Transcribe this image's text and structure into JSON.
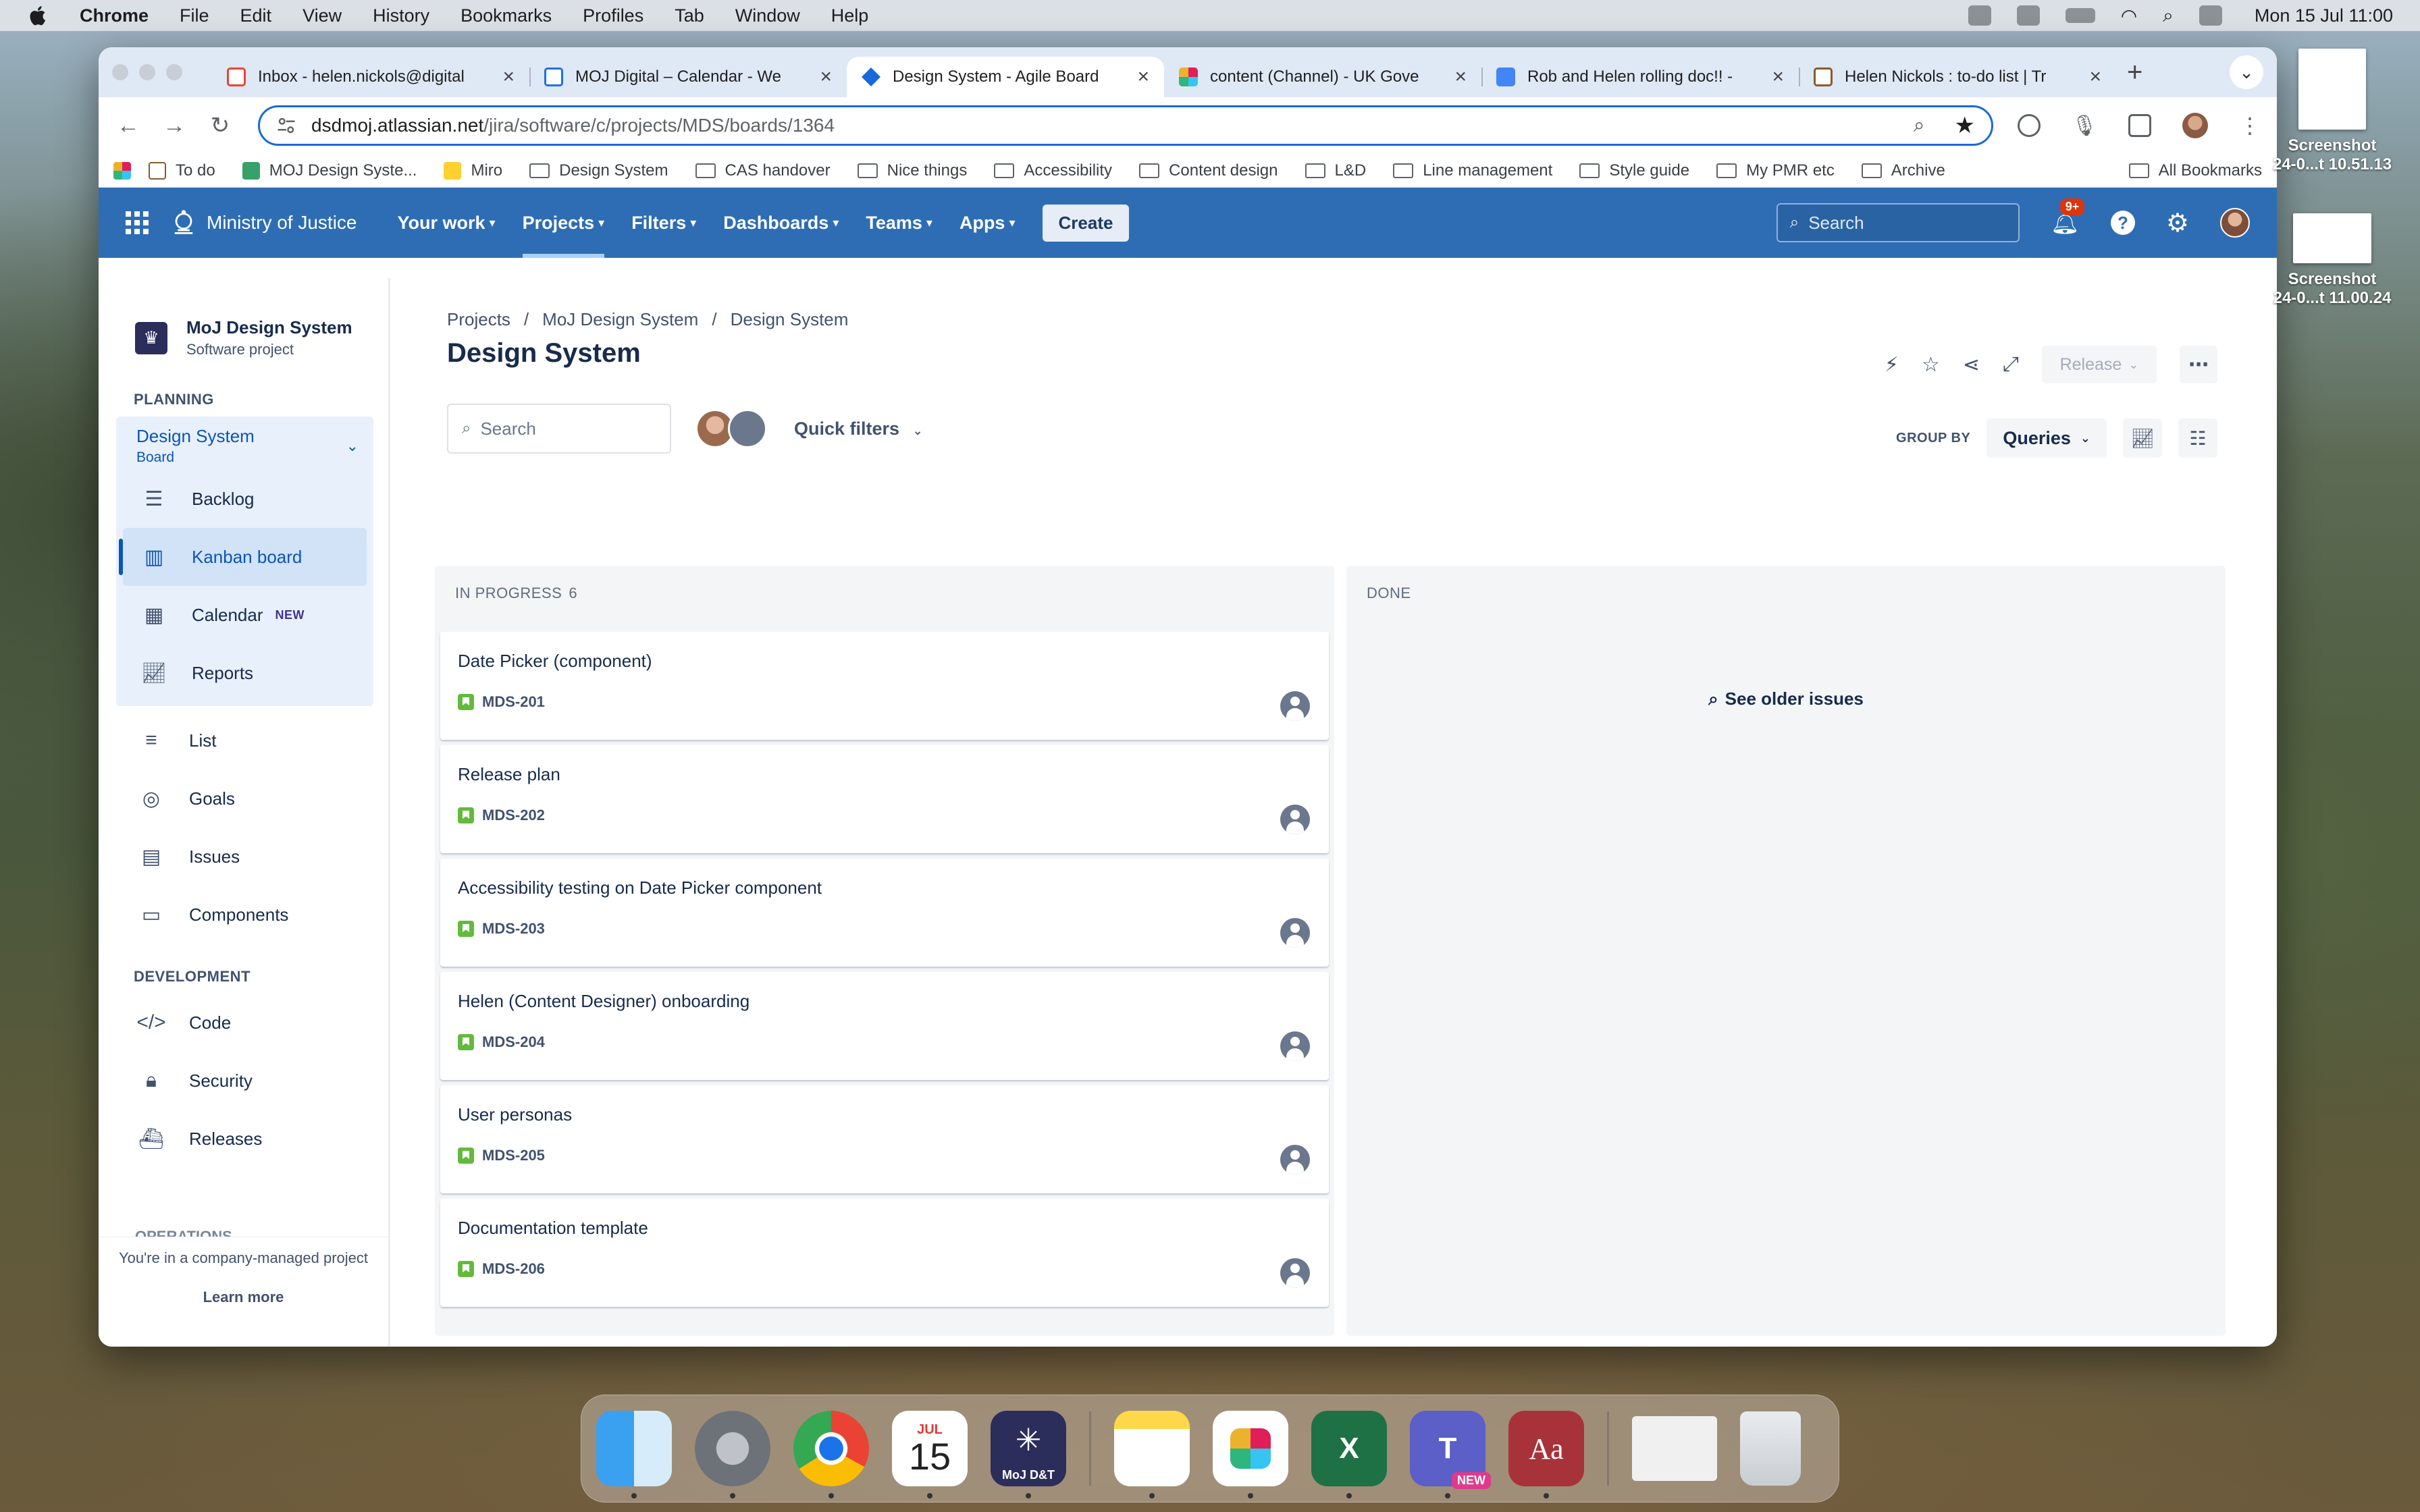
{
  "menubar": {
    "app": "Chrome",
    "items": [
      "File",
      "Edit",
      "View",
      "History",
      "Bookmarks",
      "Profiles",
      "Tab",
      "Window",
      "Help"
    ],
    "clock": "Mon 15 Jul  11:00"
  },
  "tabs": [
    {
      "title": "Inbox - helen.nickols@digital",
      "favicon_color": "#ea4335"
    },
    {
      "title": "MOJ Digital – Calendar - We",
      "favicon_color": "#1a73e8"
    },
    {
      "title": "Design System - Agile Board",
      "favicon_color": "#1868db",
      "active": true
    },
    {
      "title": "content (Channel) - UK Gove",
      "favicon_color": "#e01e5a"
    },
    {
      "title": "Rob and Helen rolling doc!! -",
      "favicon_color": "#4285f4"
    },
    {
      "title": "Helen Nickols : to-do list | Tr",
      "favicon_color": "#8a5a2b"
    }
  ],
  "toolbar": {
    "url_host": "dsdmoj.atlassian.net",
    "url_path": "/jira/software/c/projects/MDS/boards/1364"
  },
  "bookmarks": [
    {
      "label": "To do",
      "type": "page"
    },
    {
      "label": "MOJ Design Syste...",
      "type": "page"
    },
    {
      "label": "Miro",
      "type": "page"
    },
    {
      "label": "Design System",
      "type": "folder"
    },
    {
      "label": "CAS handover",
      "type": "folder"
    },
    {
      "label": "Nice things",
      "type": "folder"
    },
    {
      "label": "Accessibility",
      "type": "folder"
    },
    {
      "label": "Content design",
      "type": "folder"
    },
    {
      "label": "L&D",
      "type": "folder"
    },
    {
      "label": "Line management",
      "type": "folder"
    },
    {
      "label": "Style guide",
      "type": "folder"
    },
    {
      "label": "My PMR etc",
      "type": "folder"
    },
    {
      "label": "Archive",
      "type": "folder"
    }
  ],
  "all_bookmarks": "All Bookmarks",
  "jira_nav": {
    "org": "Ministry of Justice",
    "items": [
      "Your work",
      "Projects",
      "Filters",
      "Dashboards",
      "Teams",
      "Apps"
    ],
    "active": "Projects",
    "create": "Create",
    "search_placeholder": "Search",
    "notifications": "9+"
  },
  "sidebar": {
    "project_name": "MoJ Design System",
    "project_type": "Software project",
    "planning_label": "PLANNING",
    "board_name": "Design System",
    "board_type": "Board",
    "planning_items": [
      {
        "label": "Backlog",
        "icon": "backlog-icon"
      },
      {
        "label": "Kanban board",
        "icon": "board-icon",
        "active": true
      },
      {
        "label": "Calendar",
        "icon": "calendar-icon",
        "tag": "NEW"
      },
      {
        "label": "Reports",
        "icon": "reports-icon"
      }
    ],
    "other_items": [
      {
        "label": "List",
        "icon": "list-icon"
      },
      {
        "label": "Goals",
        "icon": "goals-icon"
      },
      {
        "label": "Issues",
        "icon": "issues-icon"
      },
      {
        "label": "Components",
        "icon": "components-icon"
      }
    ],
    "development_label": "DEVELOPMENT",
    "dev_items": [
      {
        "label": "Code",
        "icon": "code-icon"
      },
      {
        "label": "Security",
        "icon": "lock-icon"
      },
      {
        "label": "Releases",
        "icon": "ship-icon"
      }
    ],
    "operations_label": "OPERATIONS",
    "footer_msg": "You're in a company-managed project",
    "learn_more": "Learn more"
  },
  "main": {
    "breadcrumbs": [
      "Projects",
      "MoJ Design System",
      "Design System"
    ],
    "title": "Design System",
    "release": "Release",
    "search_placeholder": "Search",
    "quick_filters": "Quick filters",
    "group_by_label": "GROUP BY",
    "group_by_value": "Queries"
  },
  "columns": {
    "in_progress": {
      "title": "IN PROGRESS",
      "count": "6"
    },
    "done": {
      "title": "DONE",
      "see_older": "See older issues"
    }
  },
  "cards": [
    {
      "summary": "Date Picker (component)",
      "key": "MDS-201"
    },
    {
      "summary": "Release plan",
      "key": "MDS-202"
    },
    {
      "summary": "Accessibility testing on Date Picker component",
      "key": "MDS-203"
    },
    {
      "summary": "Helen (Content Designer) onboarding",
      "key": "MDS-204"
    },
    {
      "summary": "User personas",
      "key": "MDS-205"
    },
    {
      "summary": "Documentation template",
      "key": "MDS-206"
    }
  ],
  "desktop_files": [
    {
      "line1": "Screenshot",
      "line2": "24-0...t 10.51.13"
    },
    {
      "line1": "Screenshot",
      "line2": "24-0...t 11.00.24"
    }
  ],
  "dock": [
    {
      "name": "finder",
      "color": "#3aa0f0",
      "label": ""
    },
    {
      "name": "settings",
      "color": "#8e9299",
      "label": ""
    },
    {
      "name": "chrome",
      "color": "#ffffff",
      "label": ""
    },
    {
      "name": "calendar",
      "color": "#ffffff",
      "label": "15",
      "month": "JUL"
    },
    {
      "name": "moj-dt",
      "color": "#2b2d5b",
      "label": "MoJ D&T"
    },
    {
      "name": "notes",
      "color": "#ffd84a",
      "label": ""
    },
    {
      "name": "slack",
      "color": "#ffffff",
      "label": ""
    },
    {
      "name": "excel",
      "color": "#1e7145",
      "label": "X"
    },
    {
      "name": "teams",
      "color": "#5b5fc7",
      "label": "T",
      "tag": "NEW"
    },
    {
      "name": "dictionary",
      "color": "#a8323a",
      "label": "Aa"
    }
  ]
}
